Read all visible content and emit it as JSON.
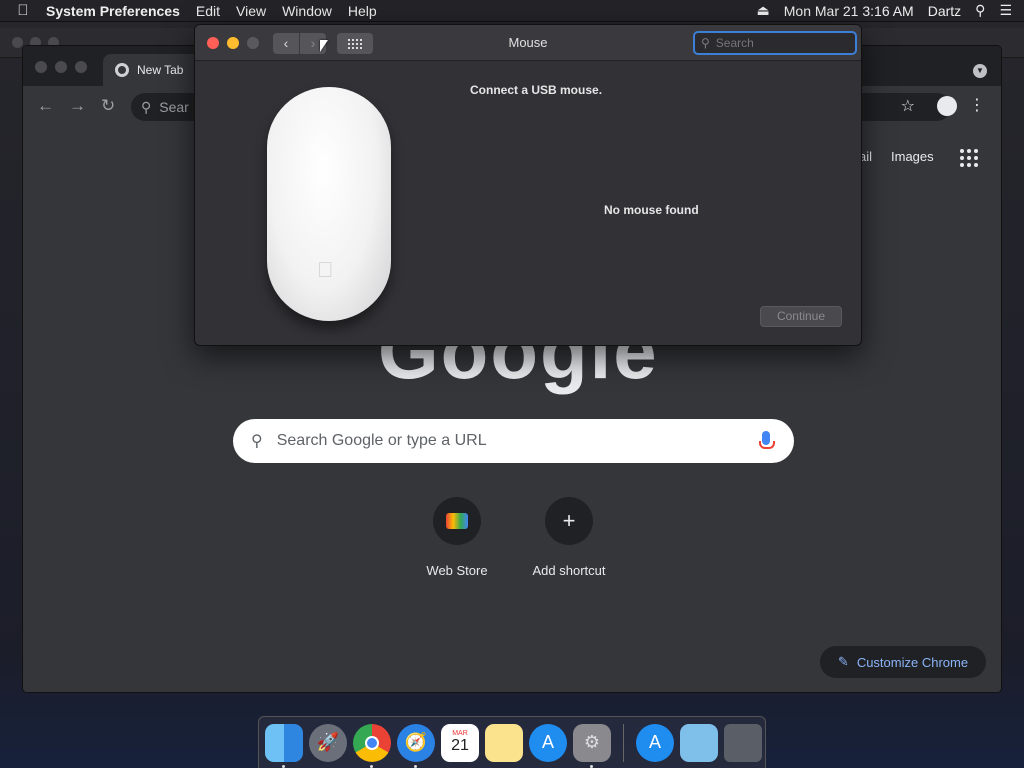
{
  "menubar": {
    "app_name": "System Preferences",
    "menus": [
      "Edit",
      "View",
      "Window",
      "Help"
    ],
    "clock": "Mon Mar 21  3:16 AM",
    "user": "Dartz"
  },
  "chrome": {
    "tab_title": "New Tab",
    "omnibox_placeholder": "Sear",
    "gmail_link": "ail",
    "images_link": "Images",
    "google_logo": "Google",
    "search_placeholder": "Search Google or type a URL",
    "shortcuts": [
      {
        "label": "Web Store",
        "icon": "webstore-icon"
      },
      {
        "label": "Add shortcut",
        "icon": "plus-icon"
      }
    ],
    "customize_label": "Customize Chrome"
  },
  "prefs": {
    "title": "Mouse",
    "search_placeholder": "Search",
    "connect_text": "Connect a USB mouse.",
    "no_mouse_text": "No mouse found",
    "continue_label": "Continue"
  },
  "dock": {
    "calendar_month": "MAR",
    "calendar_day": "21",
    "apps": [
      "finder-icon",
      "launchpad-icon",
      "chrome-icon",
      "safari-icon",
      "calendar-icon",
      "notes-icon",
      "app-store-icon",
      "system-preferences-icon",
      "app-store-installer-icon",
      "downloads-folder-icon",
      "trash-icon"
    ]
  },
  "colors": {
    "accent_blue": "#3c7fd6",
    "close_red": "#ff5f57",
    "minimize_yellow": "#febc2e",
    "zoom_gray": "#5a5a5e",
    "link_blue": "#8ab4f8"
  }
}
